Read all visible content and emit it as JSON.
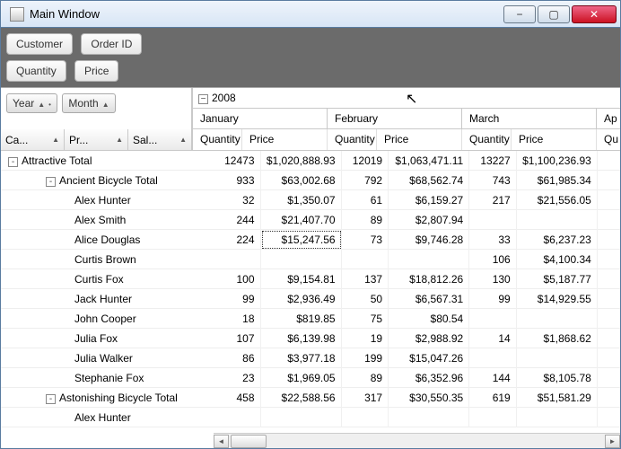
{
  "window": {
    "title": "Main Window"
  },
  "chips": {
    "customer": "Customer",
    "order_id": "Order ID",
    "quantity": "Quantity",
    "price": "Price"
  },
  "colaxis": {
    "year": "Year",
    "month": "Month"
  },
  "rowaxis": {
    "category": "Ca...",
    "product": "Pr...",
    "sales": "Sal..."
  },
  "year": "2008",
  "months": {
    "jan": "January",
    "feb": "February",
    "mar": "March",
    "apr": "Ap"
  },
  "measures": {
    "quantity": "Quantity",
    "price": "Price",
    "qshort": "Qu"
  },
  "rows": [
    {
      "label": "Attractive Total",
      "indent": 0,
      "collapse": "-",
      "jan_q": "12473",
      "jan_p": "$1,020,888.93",
      "feb_q": "12019",
      "feb_p": "$1,063,471.11",
      "mar_q": "13227",
      "mar_p": "$1,100,236.93"
    },
    {
      "label": "Ancient Bicycle Total",
      "indent": 1,
      "collapse": "-",
      "jan_q": "933",
      "jan_p": "$63,002.68",
      "feb_q": "792",
      "feb_p": "$68,562.74",
      "mar_q": "743",
      "mar_p": "$61,985.34"
    },
    {
      "label": "Alex Hunter",
      "indent": 2,
      "jan_q": "32",
      "jan_p": "$1,350.07",
      "feb_q": "61",
      "feb_p": "$6,159.27",
      "mar_q": "217",
      "mar_p": "$21,556.05"
    },
    {
      "label": "Alex Smith",
      "indent": 2,
      "jan_q": "244",
      "jan_p": "$21,407.70",
      "feb_q": "89",
      "feb_p": "$2,807.94",
      "mar_q": "",
      "mar_p": ""
    },
    {
      "label": "Alice Douglas",
      "indent": 2,
      "focus": true,
      "jan_q": "224",
      "jan_p": "$15,247.56",
      "feb_q": "73",
      "feb_p": "$9,746.28",
      "mar_q": "33",
      "mar_p": "$6,237.23"
    },
    {
      "label": "Curtis Brown",
      "indent": 2,
      "jan_q": "",
      "jan_p": "",
      "feb_q": "",
      "feb_p": "",
      "mar_q": "106",
      "mar_p": "$4,100.34"
    },
    {
      "label": "Curtis Fox",
      "indent": 2,
      "jan_q": "100",
      "jan_p": "$9,154.81",
      "feb_q": "137",
      "feb_p": "$18,812.26",
      "mar_q": "130",
      "mar_p": "$5,187.77"
    },
    {
      "label": "Jack Hunter",
      "indent": 2,
      "jan_q": "99",
      "jan_p": "$2,936.49",
      "feb_q": "50",
      "feb_p": "$6,567.31",
      "mar_q": "99",
      "mar_p": "$14,929.55"
    },
    {
      "label": "John Cooper",
      "indent": 2,
      "jan_q": "18",
      "jan_p": "$819.85",
      "feb_q": "75",
      "feb_p": "$80.54",
      "mar_q": "",
      "mar_p": ""
    },
    {
      "label": "Julia Fox",
      "indent": 2,
      "jan_q": "107",
      "jan_p": "$6,139.98",
      "feb_q": "19",
      "feb_p": "$2,988.92",
      "mar_q": "14",
      "mar_p": "$1,868.62"
    },
    {
      "label": "Julia Walker",
      "indent": 2,
      "jan_q": "86",
      "jan_p": "$3,977.18",
      "feb_q": "199",
      "feb_p": "$15,047.26",
      "mar_q": "",
      "mar_p": ""
    },
    {
      "label": "Stephanie Fox",
      "indent": 2,
      "jan_q": "23",
      "jan_p": "$1,969.05",
      "feb_q": "89",
      "feb_p": "$6,352.96",
      "mar_q": "144",
      "mar_p": "$8,105.78"
    },
    {
      "label": "Astonishing Bicycle Total",
      "indent": 1,
      "collapse": "-",
      "jan_q": "458",
      "jan_p": "$22,588.56",
      "feb_q": "317",
      "feb_p": "$30,550.35",
      "mar_q": "619",
      "mar_p": "$51,581.29"
    },
    {
      "label": "Alex Hunter",
      "indent": 2,
      "jan_q": "",
      "jan_p": "",
      "feb_q": "",
      "feb_p": "",
      "mar_q": "",
      "mar_p": ""
    }
  ]
}
